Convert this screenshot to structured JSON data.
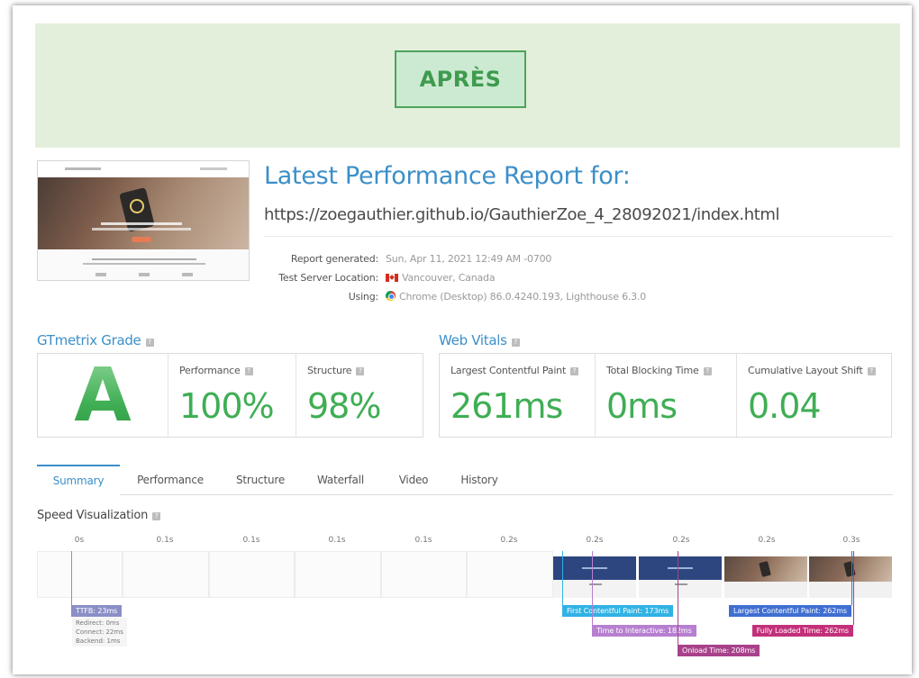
{
  "banner": {
    "label": "APRÈS"
  },
  "report": {
    "title": "Latest Performance Report for:",
    "url": "https://zoegauthier.github.io/GauthierZoe_4_28092021/index.html",
    "meta": [
      {
        "key": "Report generated:",
        "value": "Sun, Apr 11, 2021 12:49 AM -0700"
      },
      {
        "key": "Test Server Location:",
        "value": "Vancouver, Canada",
        "icon": "canada-flag-icon"
      },
      {
        "key": "Using:",
        "value": "Chrome (Desktop) 86.0.4240.193, Lighthouse 6.3.0",
        "icon": "chrome-icon"
      }
    ]
  },
  "gtmetrix": {
    "title": "GTmetrix Grade",
    "grade": "A",
    "performance": {
      "label": "Performance",
      "value": "100%"
    },
    "structure": {
      "label": "Structure",
      "value": "98%"
    }
  },
  "vitals": {
    "title": "Web Vitals",
    "lcp": {
      "label": "Largest Contentful Paint",
      "value": "261ms"
    },
    "tbt": {
      "label": "Total Blocking Time",
      "value": "0ms"
    },
    "cls": {
      "label": "Cumulative Layout Shift",
      "value": "0.04"
    }
  },
  "help_glyph": "?",
  "tabs": [
    "Summary",
    "Performance",
    "Structure",
    "Waterfall",
    "Video",
    "History"
  ],
  "active_tab": "Summary",
  "speed": {
    "title": "Speed Visualization",
    "times": [
      "0s",
      "0.1s",
      "0.1s",
      "0.1s",
      "0.1s",
      "0.2s",
      "0.2s",
      "0.2s",
      "0.2s",
      "0.3s"
    ],
    "markers": {
      "ttfb": "TTFB: 23ms",
      "ttfb_details": [
        "Redirect: 0ms",
        "Connect: 22ms",
        "Backend: 1ms"
      ],
      "fcp": "First Contentful Paint: 173ms",
      "tti": "Time to Interactive: 182ms",
      "onload": "Onload Time: 208ms",
      "lcp": "Largest Contentful Paint: 262ms",
      "fully": "Fully Loaded Time: 262ms"
    },
    "colors": {
      "ttfb": "#8a8fc7",
      "fcp": "#31b2e4",
      "tti": "#b77fd0",
      "onload": "#a8428a",
      "lcp": "#3f6fd1",
      "fully": "#c2307a"
    }
  }
}
